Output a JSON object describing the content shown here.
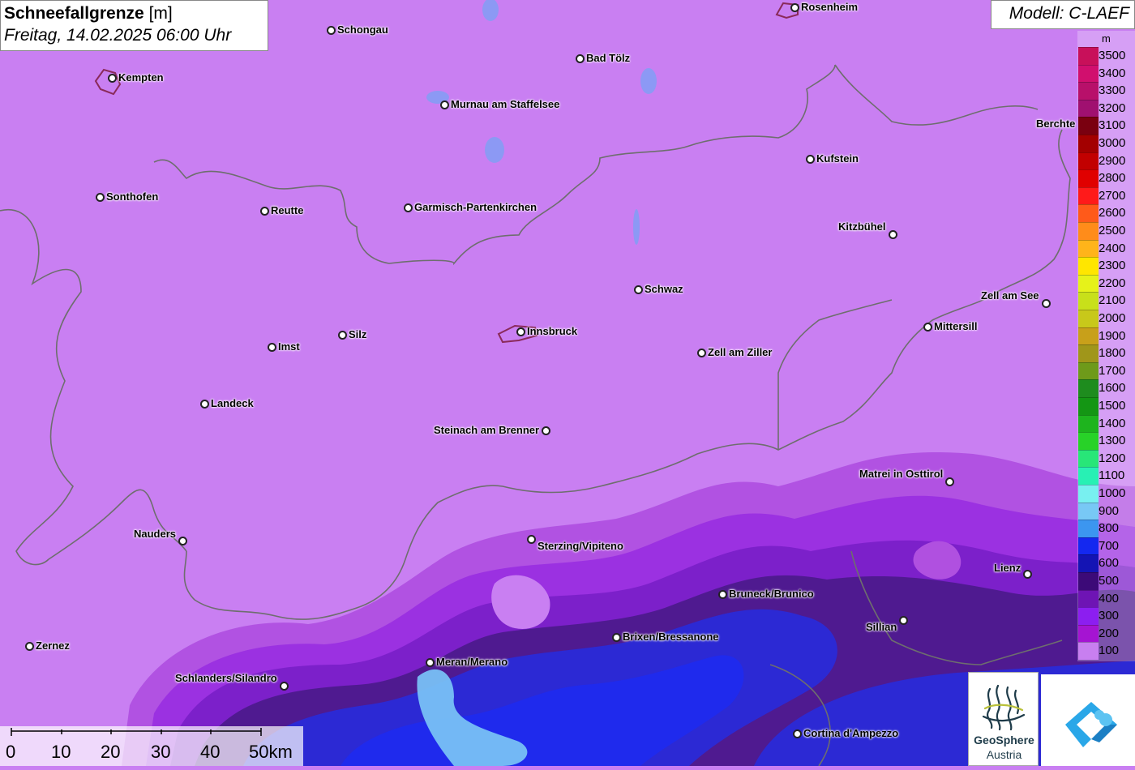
{
  "title": {
    "main": "Schneefallgrenze",
    "unit": " [m]",
    "datetime": "Freitag, 14.02.2025 06:00 Uhr"
  },
  "model": "Modell: C-LAEF",
  "legend": {
    "unit": "m",
    "levels": [
      {
        "label": "3500",
        "color": "#c8105a"
      },
      {
        "label": "3400",
        "color": "#d10f6e"
      },
      {
        "label": "3300",
        "color": "#b8106a"
      },
      {
        "label": "3200",
        "color": "#a01070"
      },
      {
        "label": "3100",
        "color": "#7a0010"
      },
      {
        "label": "3000",
        "color": "#a30000"
      },
      {
        "label": "2900",
        "color": "#c20000"
      },
      {
        "label": "2800",
        "color": "#e00000"
      },
      {
        "label": "2700",
        "color": "#ff1a1a"
      },
      {
        "label": "2600",
        "color": "#ff5a1a"
      },
      {
        "label": "2500",
        "color": "#ff8c1a"
      },
      {
        "label": "2400",
        "color": "#ffb41a"
      },
      {
        "label": "2300",
        "color": "#ffe600"
      },
      {
        "label": "2200",
        "color": "#e6f21a"
      },
      {
        "label": "2100",
        "color": "#c8e01a"
      },
      {
        "label": "2000",
        "color": "#c8c81a"
      },
      {
        "label": "1900",
        "color": "#c8a01a"
      },
      {
        "label": "1800",
        "color": "#a0961a"
      },
      {
        "label": "1700",
        "color": "#6e9a1a"
      },
      {
        "label": "1600",
        "color": "#1e8c1e"
      },
      {
        "label": "1500",
        "color": "#149614"
      },
      {
        "label": "1400",
        "color": "#1eb41e"
      },
      {
        "label": "1300",
        "color": "#28d228"
      },
      {
        "label": "1200",
        "color": "#28e678"
      },
      {
        "label": "1100",
        "color": "#28f0b4"
      },
      {
        "label": "1000",
        "color": "#78f0f0"
      },
      {
        "label": "900",
        "color": "#78c8f5"
      },
      {
        "label": "800",
        "color": "#3c96f0"
      },
      {
        "label": "700",
        "color": "#1428f0"
      },
      {
        "label": "600",
        "color": "#1414b4"
      },
      {
        "label": "500",
        "color": "#3c0a78"
      },
      {
        "label": "400",
        "color": "#6e14b4"
      },
      {
        "label": "300",
        "color": "#8c1ef0"
      },
      {
        "label": "200",
        "color": "#a514d2"
      },
      {
        "label": "100",
        "color": "#c87ff0"
      }
    ]
  },
  "cities": [
    {
      "name": "Rosenheim",
      "label_side": "right"
    },
    {
      "name": "Schongau",
      "label_side": "right"
    },
    {
      "name": "Kempten",
      "label_side": "right"
    },
    {
      "name": "Bad Tölz",
      "label_side": "right"
    },
    {
      "name": "Murnau am Staffelsee",
      "label_side": "right"
    },
    {
      "name": "Berchte",
      "label_side": "left"
    },
    {
      "name": "Kufstein",
      "label_side": "right"
    },
    {
      "name": "Sonthofen",
      "label_side": "right"
    },
    {
      "name": "Reutte",
      "label_side": "right"
    },
    {
      "name": "Garmisch-Partenkirchen",
      "label_side": "right"
    },
    {
      "name": "Kitzbühel",
      "label_side": "left"
    },
    {
      "name": "Schwaz",
      "label_side": "right"
    },
    {
      "name": "Zell am See",
      "label_side": "left"
    },
    {
      "name": "Mittersill",
      "label_side": "right"
    },
    {
      "name": "Innsbruck",
      "label_side": "right"
    },
    {
      "name": "Silz",
      "label_side": "right"
    },
    {
      "name": "Imst",
      "label_side": "right"
    },
    {
      "name": "Zell am Ziller",
      "label_side": "right"
    },
    {
      "name": "Landeck",
      "label_side": "right"
    },
    {
      "name": "Steinach am Brenner",
      "label_side": "left"
    },
    {
      "name": "Matrei in Osttirol",
      "label_side": "left"
    },
    {
      "name": "Nauders",
      "label_side": "left"
    },
    {
      "name": "Sterzing/Vipiteno",
      "label_side": "right"
    },
    {
      "name": "Lienz",
      "label_side": "left"
    },
    {
      "name": "Bruneck/Brunico",
      "label_side": "right"
    },
    {
      "name": "Sillian",
      "label_side": "left"
    },
    {
      "name": "Brixen/Bressanone",
      "label_side": "right"
    },
    {
      "name": "Zernez",
      "label_side": "right"
    },
    {
      "name": "Meran/Merano",
      "label_side": "right"
    },
    {
      "name": "Schlanders/Silandro",
      "label_side": "left"
    },
    {
      "name": "Cortina d'Ampezzo",
      "label_side": "right"
    }
  ],
  "scale": {
    "labels": [
      "0",
      "10",
      "20",
      "30",
      "40",
      "50km"
    ]
  },
  "logos": {
    "geosphere_name": "GeoSphere",
    "geosphere_sub": "Austria"
  },
  "colors": {
    "base_fill": "#c97ff2",
    "border_line": "#6e6e6e"
  }
}
